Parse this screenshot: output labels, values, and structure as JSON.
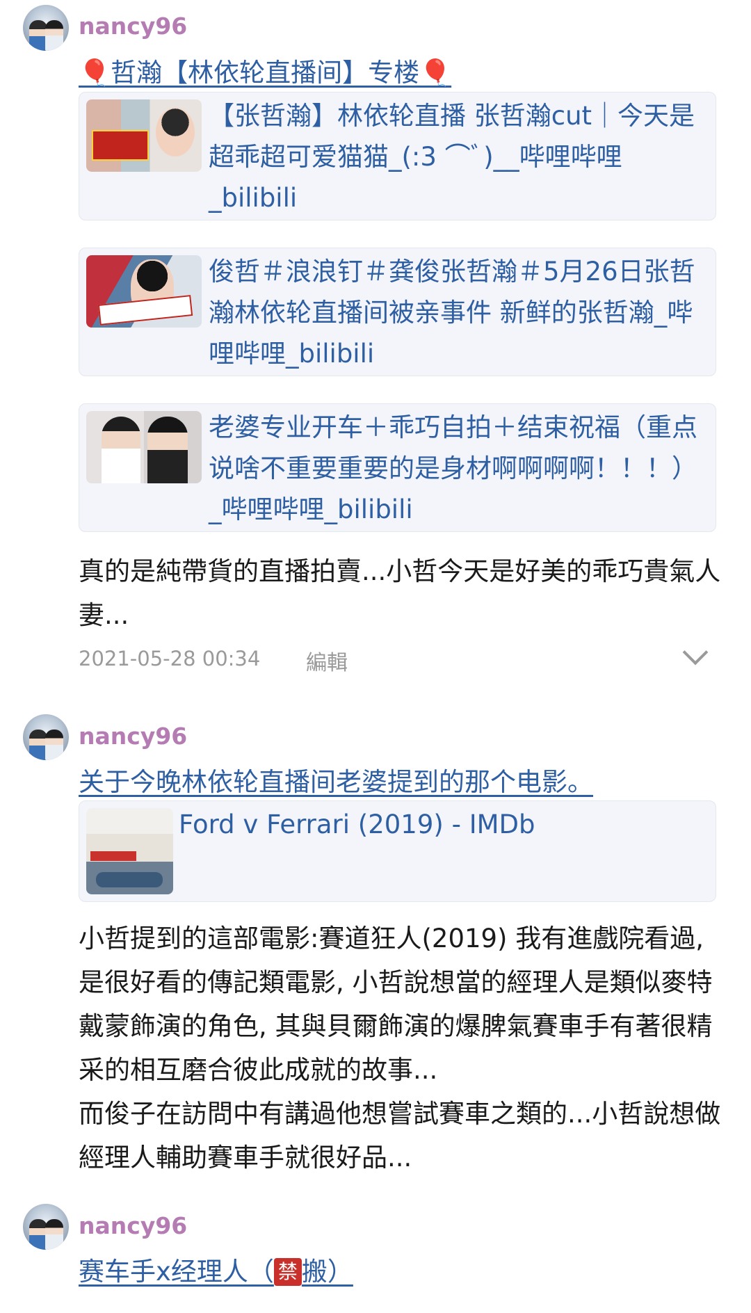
{
  "posts": [
    {
      "username": "nancy96",
      "title": "🎈哲瀚【林依轮直播间】专楼🎈",
      "cards": [
        {
          "title": "【张哲瀚】林依轮直播 张哲瀚cut｜今天是超乖超可爱猫猫_(:3 ⌒ﾞ)__哔哩哔哩_bilibili"
        },
        {
          "title": "俊哲＃浪浪钉＃龚俊张哲瀚＃5月26日张哲瀚林依轮直播间被亲事件 新鲜的张哲瀚_哔哩哔哩_bilibili"
        },
        {
          "title": "老婆专业开车＋乖巧自拍＋结束祝福（重点说啥不重要重要的是身材啊啊啊啊！！！）_哔哩哔哩_bilibili"
        }
      ],
      "body": "真的是純帶貨的直播拍賣...小哲今天是好美的乖巧貴氣人妻...",
      "timestamp": "2021-05-28 00:34",
      "edit_label": "編輯"
    },
    {
      "username": "nancy96",
      "title": "关于今晚林依轮直播间老婆提到的那个电影。",
      "cards": [
        {
          "title": "Ford v Ferrari (2019) - IMDb"
        }
      ],
      "body": "小哲提到的這部電影:賽道狂人(2019) 我有進戲院看過, 是很好看的傳記類電影, 小哲說想當的經理人是類似麥特戴蒙飾演的角色, 其與貝爾飾演的爆脾氣賽車手有著很精采的相互磨合彼此成就的故事...\n而俊子在訪問中有講過他想嘗試賽車之類的...小哲說想做經理人輔助賽車手就很好品..."
    },
    {
      "username": "nancy96",
      "title_before": "赛车手x经理人（",
      "title_badge": "禁",
      "title_after": "搬）"
    }
  ],
  "colors": {
    "username": "#b47cb2",
    "link": "#2f5fa3",
    "card_bg": "#f3f5fa",
    "meta": "#9a9a9a"
  },
  "icons": [
    "balloon-icon",
    "chevron-down-icon",
    "ban-badge-icon"
  ]
}
